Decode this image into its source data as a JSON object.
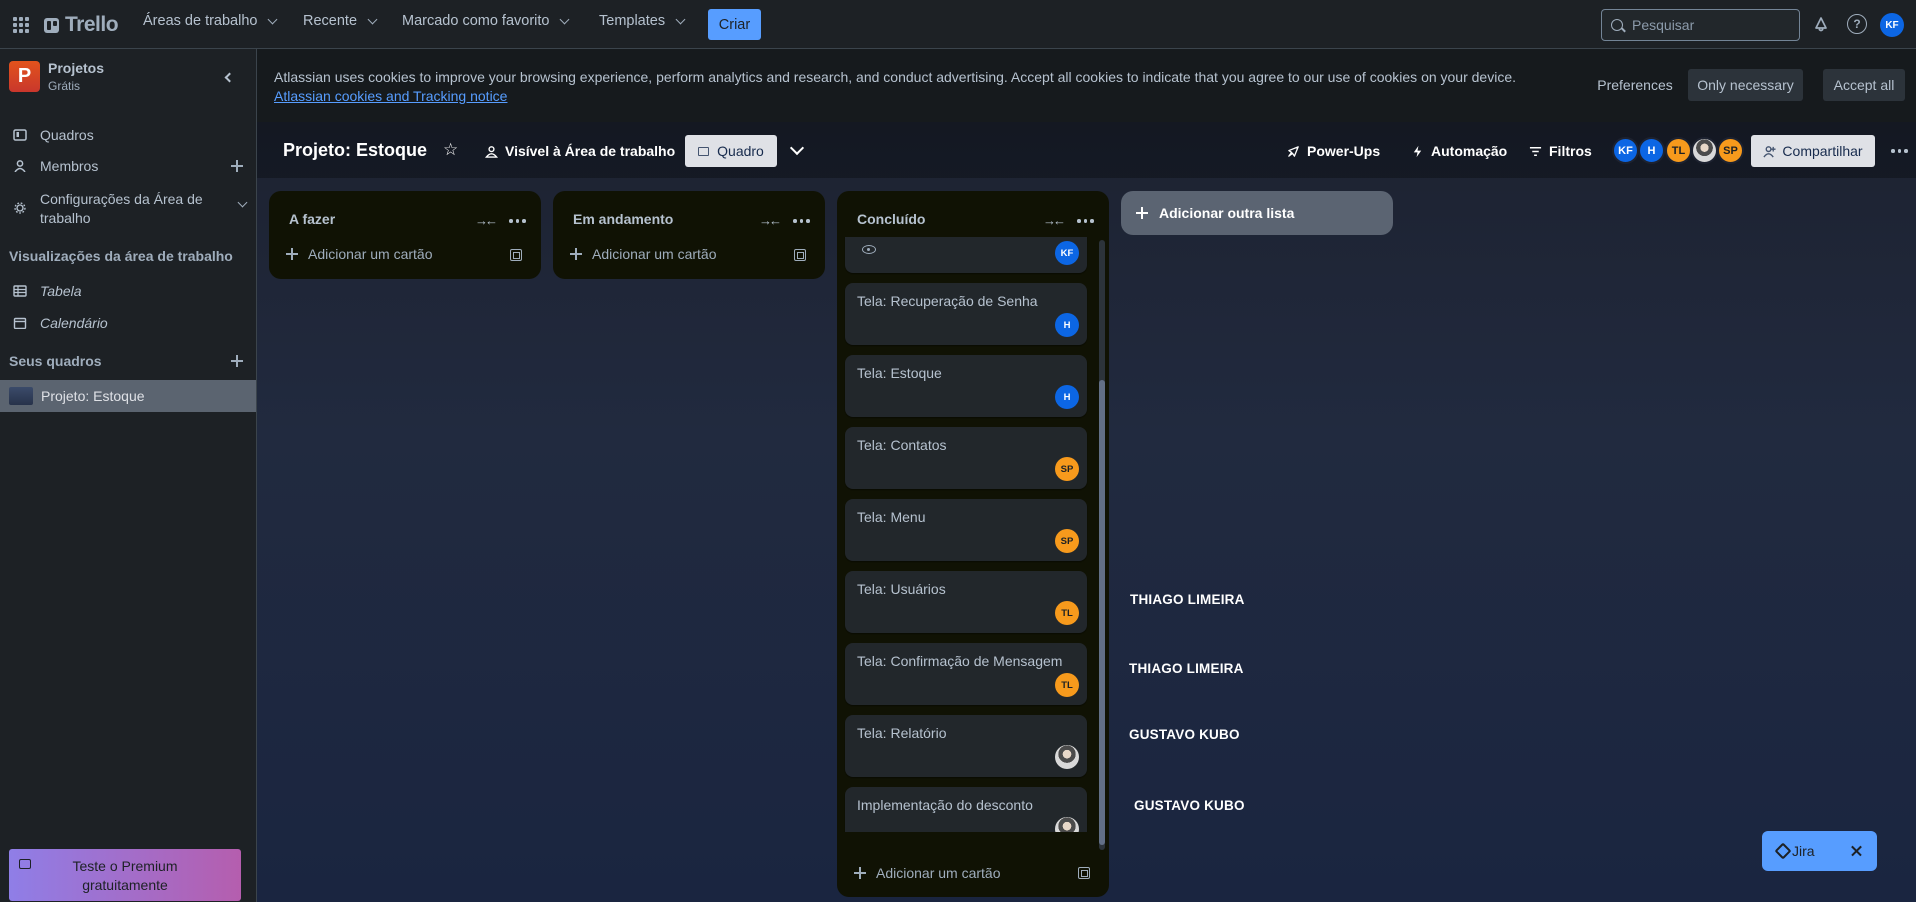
{
  "topnav": {
    "brand": "Trello",
    "menus": [
      "Áreas de trabalho",
      "Recente",
      "Marcado como favorito",
      "Templates"
    ],
    "create_label": "Criar",
    "search_placeholder": "Pesquisar",
    "user_initials": "KF",
    "help_glyph": "?"
  },
  "sidebar": {
    "workspace_initial": "P",
    "workspace_name": "Projetos",
    "workspace_plan": "Grátis",
    "nav": [
      "Quadros",
      "Membros",
      "Configurações da Área de",
      "trabalho"
    ],
    "views_title": "Visualizações da área de trabalho",
    "views": [
      "Tabela",
      "Calendário"
    ],
    "boards_title": "Seus quadros",
    "active_board": "Projeto: Estoque",
    "premium_line1": "Teste o Premium",
    "premium_line2": "gratuitamente"
  },
  "cookie_banner": {
    "text": "Atlassian uses cookies to improve your browsing experience, perform analytics and research, and conduct advertising. Accept all cookies to indicate that you agree to our use of cookies on your device.",
    "link": "Atlassian cookies and Tracking notice",
    "preferences": "Preferences",
    "only_necessary": "Only necessary",
    "accept_all": "Accept all"
  },
  "board": {
    "title": "Projeto: Estoque",
    "visibility": "Visível à Área de trabalho",
    "view": "Quadro",
    "powerups": "Power-Ups",
    "automation": "Automação",
    "filters": "Filtros",
    "share": "Compartilhar",
    "members": [
      {
        "initials": "KF",
        "color": "#0c66e4"
      },
      {
        "initials": "H",
        "color": "#0c66e4"
      },
      {
        "initials": "TL",
        "color": "#f79a1c"
      },
      {
        "initials": "",
        "color": "#6b6b6b"
      },
      {
        "initials": "SP",
        "color": "#f79a1c"
      }
    ]
  },
  "lists": [
    {
      "title": "A fazer",
      "add_card": "Adicionar um cartão"
    },
    {
      "title": "Em andamento",
      "add_card": "Adicionar um cartão"
    },
    {
      "title": "Concluído",
      "add_card": "Adicionar um cartão",
      "cards": [
        {
          "title": "",
          "member": "KF",
          "color": "#0c66e4",
          "watching": true
        },
        {
          "title": "Tela: Recuperação de Senha",
          "member": "H",
          "color": "#0c66e4"
        },
        {
          "title": "Tela: Estoque",
          "member": "H",
          "color": "#0c66e4"
        },
        {
          "title": "Tela: Contatos",
          "member": "SP",
          "color": "#f79a1c"
        },
        {
          "title": "Tela: Menu",
          "member": "SP",
          "color": "#f79a1c"
        },
        {
          "title": "Tela: Usuários",
          "member": "TL",
          "color": "#f79a1c"
        },
        {
          "title": "Tela: Confirmação de Mensagem",
          "member": "TL",
          "color": "#f79a1c"
        },
        {
          "title": "Tela: Relatório",
          "member": "",
          "color": "photo"
        },
        {
          "title": "Implementação do desconto",
          "member": "",
          "color": "photo"
        }
      ]
    }
  ],
  "add_list": "Adicionar outra lista",
  "annotations": [
    "THIAGO LIMEIRA",
    "THIAGO LIMEIRA",
    "GUSTAVO KUBO",
    "GUSTAVO KUBO"
  ],
  "jira": {
    "label": "Jira"
  }
}
